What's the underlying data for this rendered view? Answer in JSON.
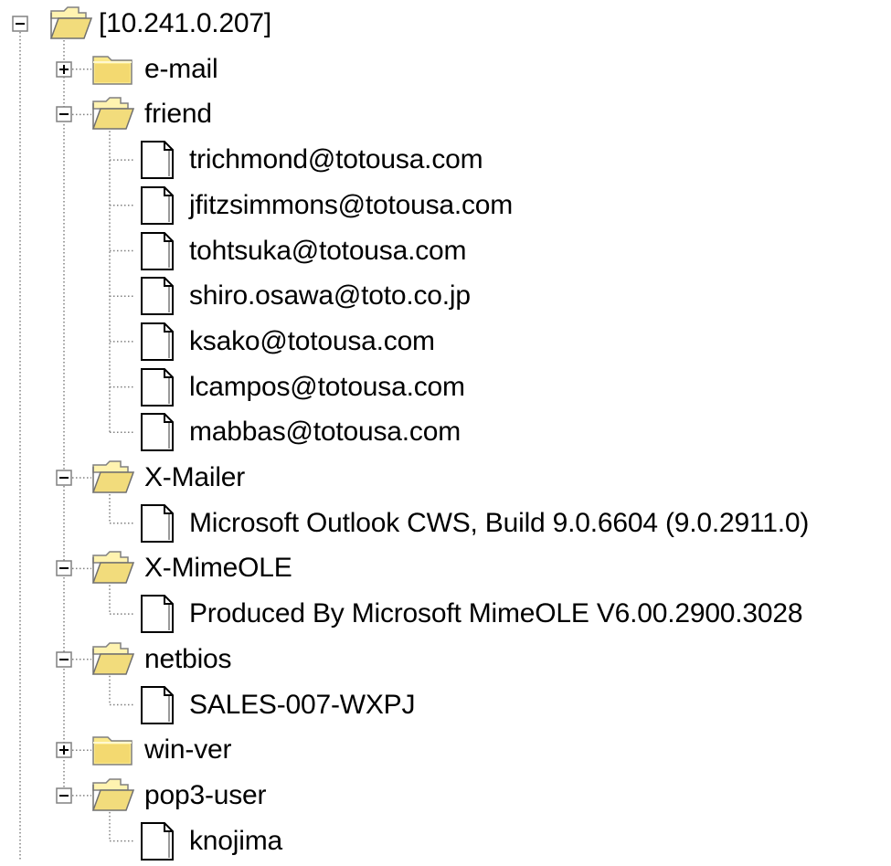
{
  "tree": {
    "root": {
      "label": "[10.241.0.207]",
      "expanded": true
    },
    "nodes": [
      {
        "label": "e-mail",
        "type": "folder",
        "expanded": false,
        "children": []
      },
      {
        "label": "friend",
        "type": "folder",
        "expanded": true,
        "children": [
          "trichmond@totousa.com",
          "jfitzsimmons@totousa.com",
          "tohtsuka@totousa.com",
          "shiro.osawa@toto.co.jp",
          "ksako@totousa.com",
          "lcampos@totousa.com",
          "mabbas@totousa.com"
        ]
      },
      {
        "label": "X-Mailer",
        "type": "folder",
        "expanded": true,
        "children": [
          "Microsoft Outlook CWS, Build 9.0.6604 (9.0.2911.0)"
        ]
      },
      {
        "label": "X-MimeOLE",
        "type": "folder",
        "expanded": true,
        "children": [
          "Produced By Microsoft MimeOLE V6.00.2900.3028"
        ]
      },
      {
        "label": "netbios",
        "type": "folder",
        "expanded": true,
        "children": [
          "SALES-007-WXPJ"
        ]
      },
      {
        "label": "win-ver",
        "type": "folder",
        "expanded": false,
        "children": []
      },
      {
        "label": "pop3-user",
        "type": "folder",
        "expanded": true,
        "children": [
          "knojima"
        ]
      }
    ]
  }
}
